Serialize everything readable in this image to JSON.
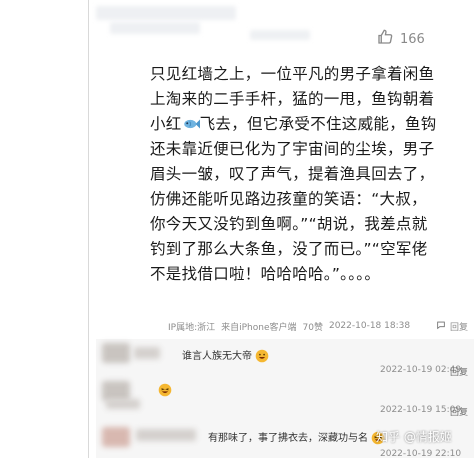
{
  "header": {
    "like_count": "166"
  },
  "comment": {
    "lines": [
      "只见红墙之上，一位平凡的男子拿着闲鱼",
      "上淘来的二手手杆，猛的一甩，鱼钩朝着",
      "飞去，但它承受不住这威能，鱼钩",
      "还未靠近便已化为了宇宙间的尘埃，男子",
      "眉头一皱，叹了声气，提着渔具回去了，",
      "仿佛还能听见路边孩童的笑语：“大叔，",
      "你今天又没钓到鱼啊。”“胡说，我差点就",
      "钓到了那么大条鱼，没了而已。”“空军佬",
      "不是找借口啦！哈哈哈哈。”。。。。"
    ],
    "line3_prefix": "小红",
    "fish_icon": "fish-emoji-icon"
  },
  "meta": {
    "location": "IP属地:浙江",
    "device": "来自iPhone客户端",
    "likes": "70赞",
    "date": "2022-10-18 18:38",
    "reply_icon": "comment-icon",
    "reply_label": "回复"
  },
  "replies": [
    {
      "text": "谁言人族无大帝",
      "emoji": "grin-emoji-icon",
      "date": "2022-10-19 02:49",
      "action": "回复"
    },
    {
      "text": "",
      "emoji": "laugh-emoji-icon",
      "date": "2022-10-19 15:09",
      "action": "回复"
    },
    {
      "text": "有那味了，事了拂衣去，深藏功与名",
      "emoji": "laugh-emoji-icon",
      "date": "2022-10-19 22:10",
      "action": "回复"
    }
  ],
  "watermark": "知乎 @情报姬",
  "colors": {
    "text": "#1a1a1a",
    "meta": "#8d8d8d",
    "reply_bg": "#f6f6f6",
    "emoji_yellow": "#f5b731"
  }
}
